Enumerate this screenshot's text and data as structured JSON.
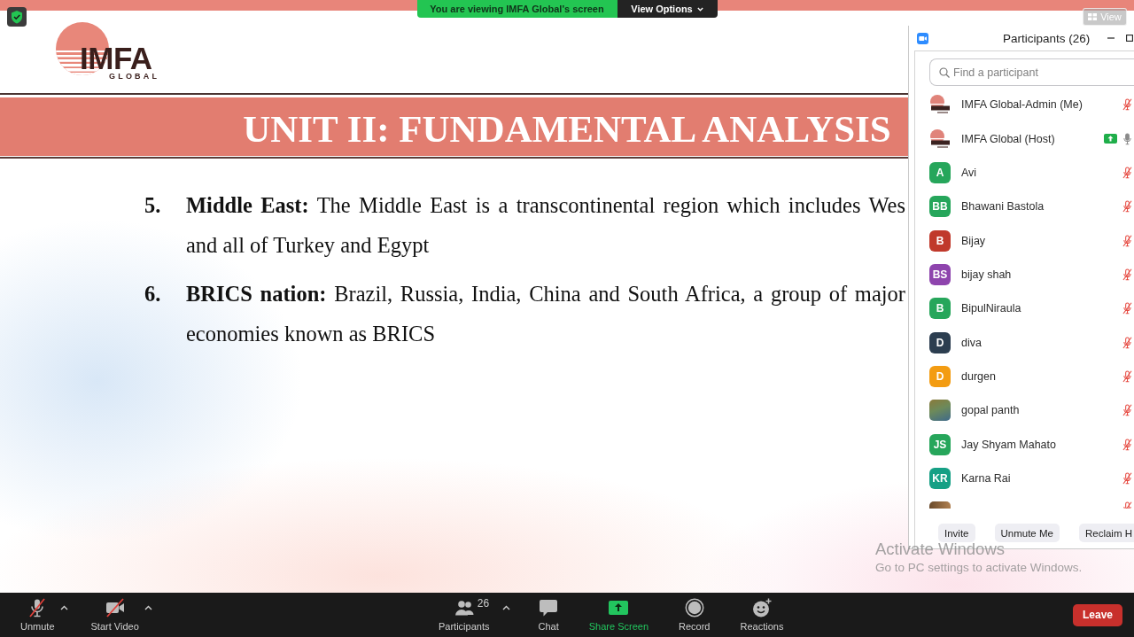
{
  "share_banner": {
    "message": "You are viewing IMFA Global's screen",
    "view_options": "View Options"
  },
  "view_button": {
    "label": "View"
  },
  "slide": {
    "logo": {
      "name": "IMFA",
      "tagline": "GLOBAL"
    },
    "title": "UNIT II: FUNDAMENTAL ANALYSIS",
    "items": [
      {
        "number": "5.",
        "term": "Middle East:",
        "lines": [
          "The Middle East is a transcontinental region which includes Wes",
          "and all of Turkey and Egypt"
        ]
      },
      {
        "number": "6.",
        "term": "BRICS nation:",
        "lines": [
          "Brazil, Russia, India, China and South Africa, a group of major",
          "economies known as BRICS"
        ]
      }
    ]
  },
  "participants_panel": {
    "title": "Participants (26)",
    "search": {
      "placeholder": "Find a participant"
    },
    "participants": [
      {
        "kind": "logo",
        "name": "IMFA Global-Admin (Me)",
        "sharing": false,
        "muted": true
      },
      {
        "kind": "logo",
        "name": "IMFA Global (Host)",
        "sharing": true,
        "muted": false
      },
      {
        "kind": "initials",
        "initials": "A",
        "color": "#26a65b",
        "name": "Avi",
        "sharing": false,
        "muted": true
      },
      {
        "kind": "initials",
        "initials": "BB",
        "color": "#26a65b",
        "name": "Bhawani Bastola",
        "sharing": false,
        "muted": true
      },
      {
        "kind": "initials",
        "initials": "B",
        "color": "#c0392b",
        "name": "Bijay",
        "sharing": false,
        "muted": true
      },
      {
        "kind": "initials",
        "initials": "BS",
        "color": "#8e44ad",
        "name": "bijay shah",
        "sharing": false,
        "muted": true
      },
      {
        "kind": "initials",
        "initials": "B",
        "color": "#26a65b",
        "name": "BipulNiraula",
        "sharing": false,
        "muted": true
      },
      {
        "kind": "initials",
        "initials": "D",
        "color": "#2c3e50",
        "name": "diva",
        "sharing": false,
        "muted": true
      },
      {
        "kind": "initials",
        "initials": "D",
        "color": "#f39c12",
        "name": "durgen",
        "sharing": false,
        "muted": true
      },
      {
        "kind": "photo",
        "name": "gopal panth",
        "sharing": false,
        "muted": true
      },
      {
        "kind": "initials",
        "initials": "JS",
        "color": "#26a65b",
        "name": "Jay Shyam Mahato",
        "sharing": false,
        "muted": true
      },
      {
        "kind": "initials",
        "initials": "KR",
        "color": "#16a085",
        "name": "Karna Rai",
        "sharing": false,
        "muted": true
      },
      {
        "kind": "photo",
        "sharing": false,
        "muted": true
      }
    ],
    "buttons": [
      "Invite",
      "Unmute Me",
      "Reclaim H"
    ]
  },
  "activation_notice": {
    "title": "Activate Windows",
    "message": "Go to PC settings to activate Windows."
  },
  "toolbar": {
    "media_controls": [
      {
        "kind": "audio",
        "label": "Unmute",
        "on": false,
        "menu": true
      },
      {
        "kind": "video",
        "label": "Start Video",
        "on": false,
        "menu": true
      }
    ],
    "meeting_controls": [
      {
        "kind": "participants",
        "label": "Participants",
        "count": "26",
        "menu": true
      },
      {
        "kind": "chat",
        "label": "Chat",
        "menu": false
      },
      {
        "kind": "share",
        "label": "Share Screen",
        "menu": false
      },
      {
        "kind": "record",
        "label": "Record",
        "menu": false
      },
      {
        "kind": "reactions",
        "label": "Reactions",
        "menu": false
      }
    ],
    "leave_button": "Leave"
  }
}
